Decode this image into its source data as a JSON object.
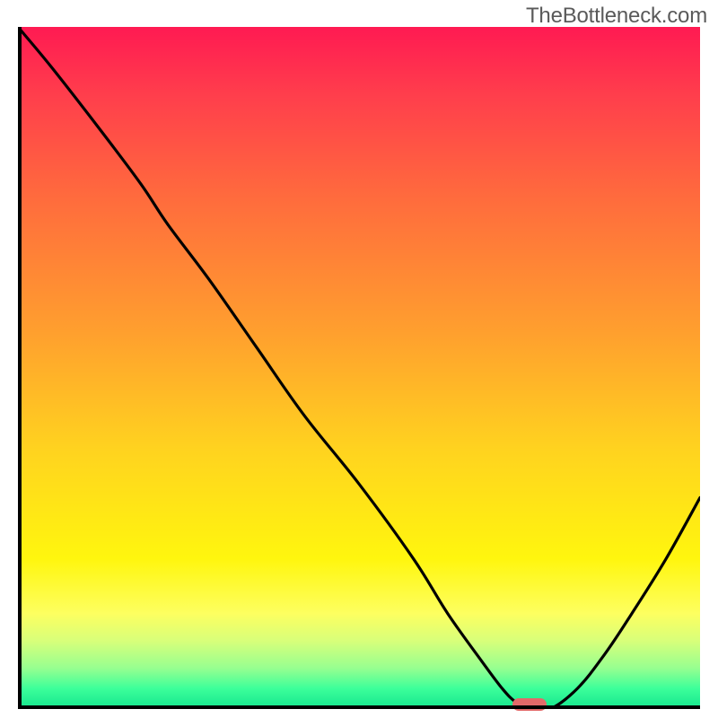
{
  "watermark": "TheBottleneck.com",
  "chart_data": {
    "type": "line",
    "title": "",
    "xlabel": "",
    "ylabel": "",
    "xlim": [
      0,
      100
    ],
    "ylim": [
      0,
      100
    ],
    "x": [
      0,
      5,
      12,
      18,
      22,
      28,
      35,
      42,
      50,
      58,
      63,
      68,
      71,
      73,
      75,
      78,
      82,
      86,
      90,
      95,
      100
    ],
    "values": [
      100,
      94,
      85,
      77,
      71,
      63,
      53,
      43,
      33,
      22,
      14,
      7,
      3,
      1,
      0,
      0,
      3,
      8,
      14,
      22,
      31
    ],
    "marker": {
      "x": 75,
      "y": 0.6,
      "color": "#e36a6a"
    },
    "gradient_stops": [
      {
        "pos": 0.0,
        "color": "#ff1a52"
      },
      {
        "pos": 0.45,
        "color": "#ffa02e"
      },
      {
        "pos": 0.78,
        "color": "#fff60e"
      },
      {
        "pos": 1.0,
        "color": "#14e58e"
      }
    ]
  }
}
